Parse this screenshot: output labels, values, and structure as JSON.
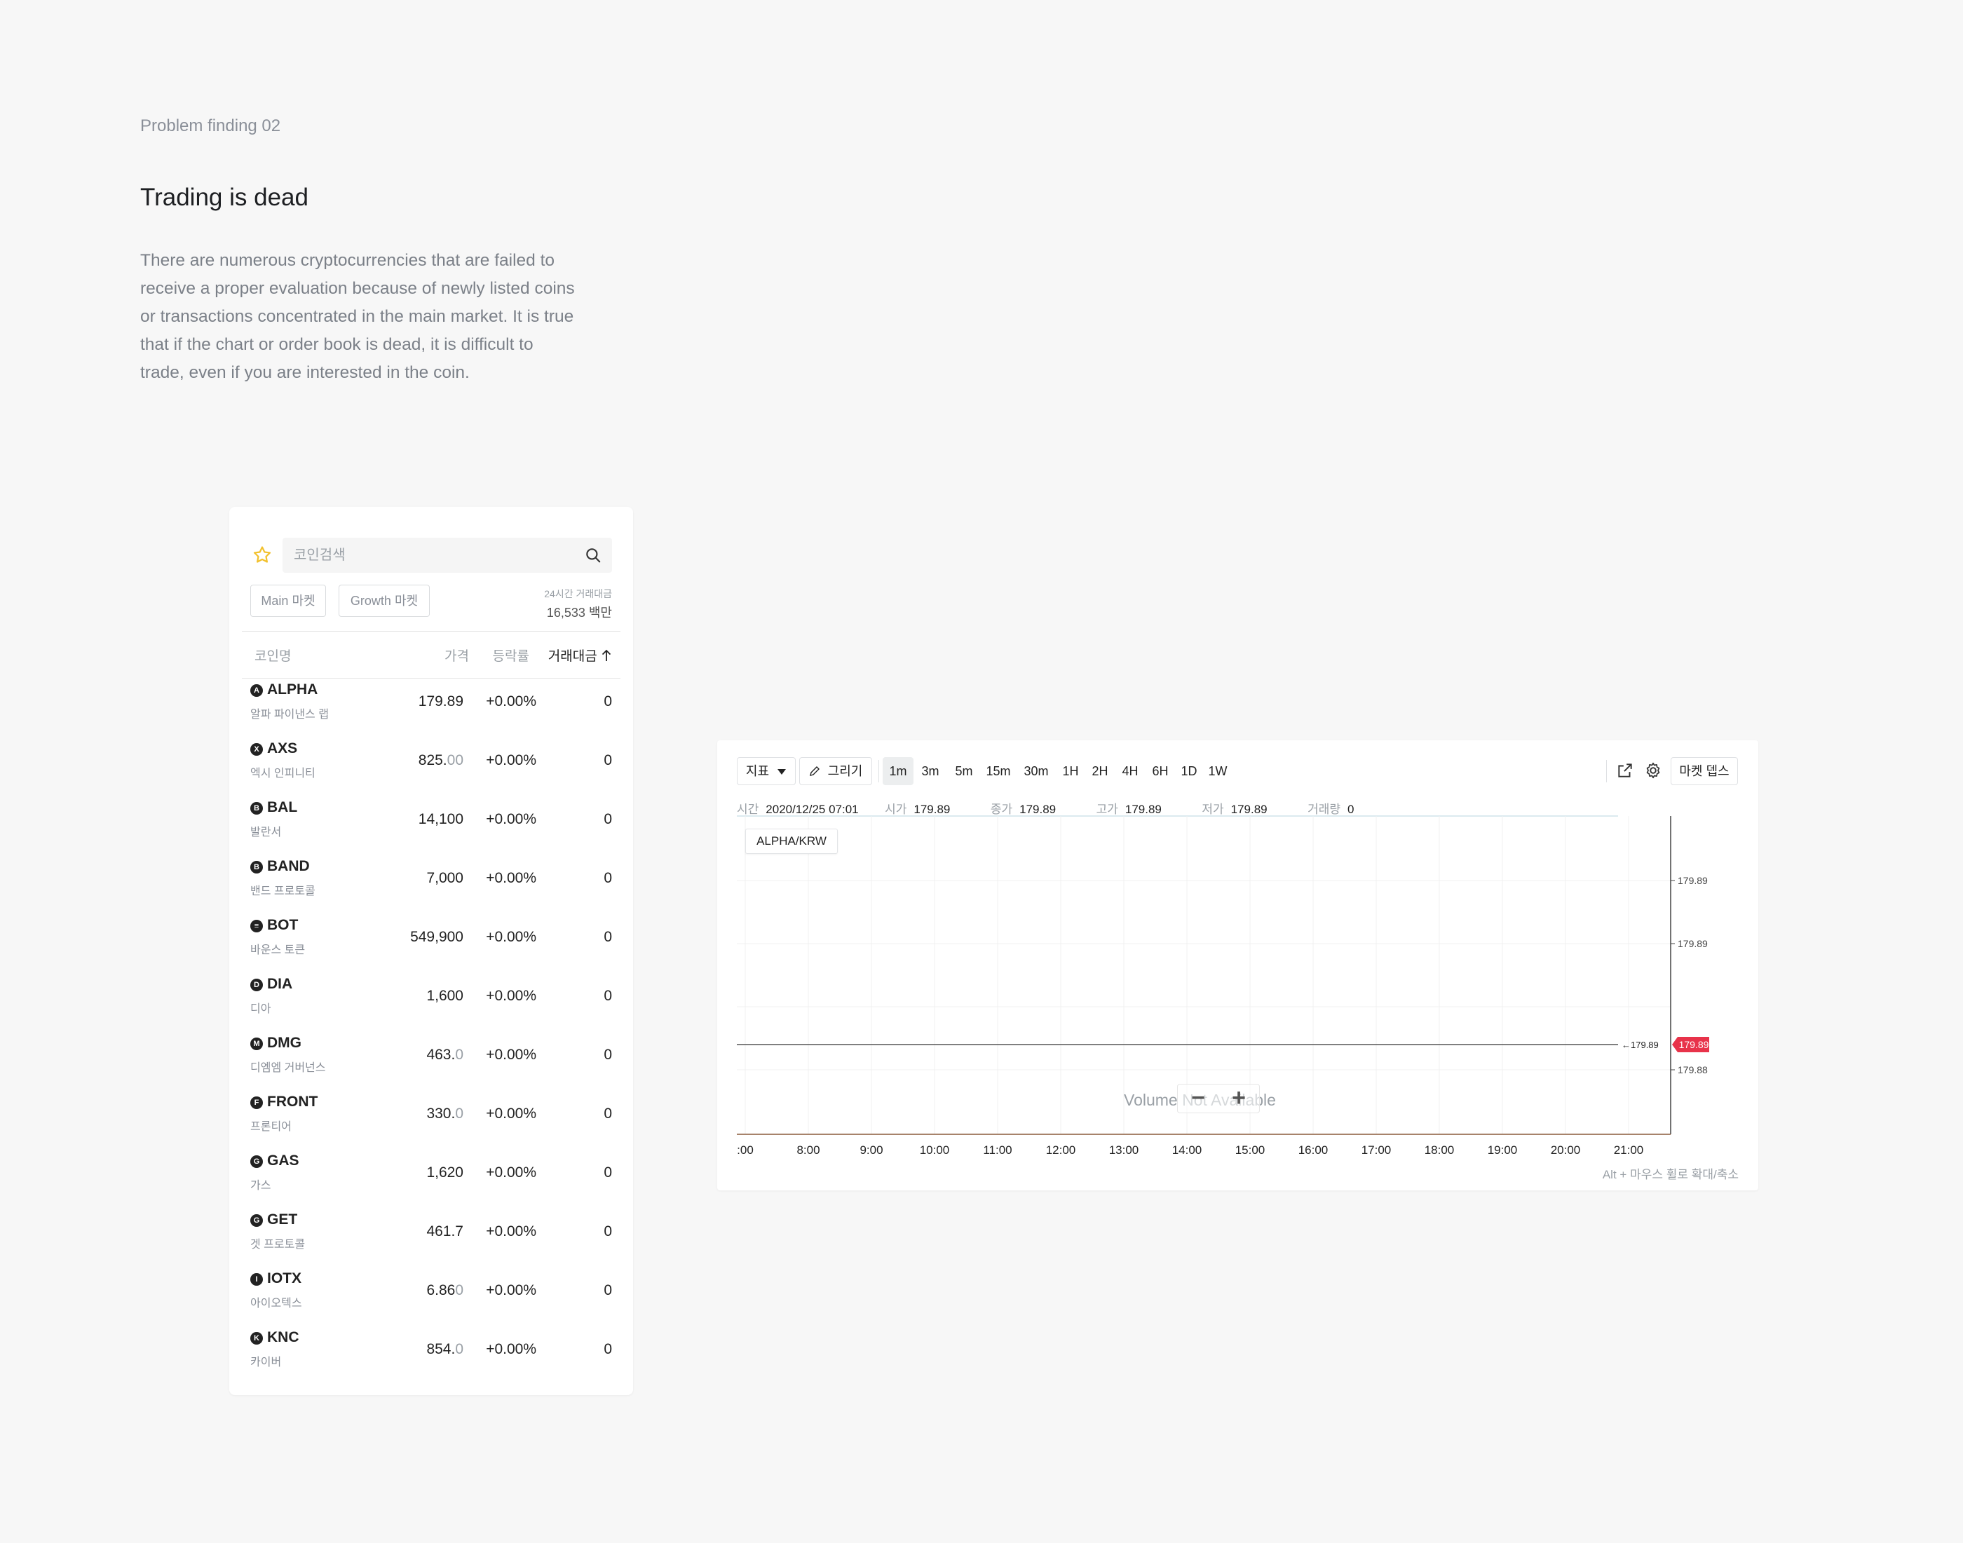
{
  "page": {
    "label": "Problem finding 02",
    "headline": "Trading is dead",
    "body_lines": [
      "There are numerous cryptocurrencies that are failed to",
      "receive a proper evaluation because of newly listed coins",
      "or transactions concentrated in the main market. It is true",
      "that if the chart or order book is dead, it is difficult to",
      "trade, even if you are interested in the coin."
    ]
  },
  "coin_list": {
    "search_placeholder": "코인검색",
    "markets": [
      "Main 마켓",
      "Growth 마켓"
    ],
    "volume_label": "24시간 거래대금",
    "volume_value": "16,533 백만",
    "headers": {
      "name": "코인명",
      "price": "가격",
      "change": "등락률",
      "volume": "거래대금",
      "sort_icon": "arrow-up-icon"
    },
    "rows": [
      {
        "icon": "A",
        "symbol": "ALPHA",
        "name": "알파 파이낸스 랩",
        "price": "179.89",
        "price_dim": "",
        "change": "+0.00%",
        "volume": "0"
      },
      {
        "icon": "X",
        "symbol": "AXS",
        "name": "엑시 인피니티",
        "price": "825.",
        "price_dim": "00",
        "change": "+0.00%",
        "volume": "0"
      },
      {
        "icon": "B",
        "symbol": "BAL",
        "name": "발란서",
        "price": "14,100",
        "price_dim": "",
        "change": "+0.00%",
        "volume": "0"
      },
      {
        "icon": "B",
        "symbol": "BAND",
        "name": "밴드 프로토콜",
        "price": "7,000",
        "price_dim": "",
        "change": "+0.00%",
        "volume": "0"
      },
      {
        "icon": "≡",
        "symbol": "BOT",
        "name": "바운스 토큰",
        "price": "549,900",
        "price_dim": "",
        "change": "+0.00%",
        "volume": "0"
      },
      {
        "icon": "D",
        "symbol": "DIA",
        "name": "디아",
        "price": "1,600",
        "price_dim": "",
        "change": "+0.00%",
        "volume": "0"
      },
      {
        "icon": "M",
        "symbol": "DMG",
        "name": "디엠엠 거버넌스",
        "price": "463.",
        "price_dim": "0",
        "change": "+0.00%",
        "volume": "0"
      },
      {
        "icon": "F",
        "symbol": "FRONT",
        "name": "프론티어",
        "price": "330.",
        "price_dim": "0",
        "change": "+0.00%",
        "volume": "0"
      },
      {
        "icon": "G",
        "symbol": "GAS",
        "name": "가스",
        "price": "1,620",
        "price_dim": "",
        "change": "+0.00%",
        "volume": "0"
      },
      {
        "icon": "G",
        "symbol": "GET",
        "name": "겟 프로토콜",
        "price": "461.7",
        "price_dim": "",
        "change": "+0.00%",
        "volume": "0"
      },
      {
        "icon": "I",
        "symbol": "IOTX",
        "name": "아이오텍스",
        "price": "6.86",
        "price_dim": "0",
        "change": "+0.00%",
        "volume": "0"
      },
      {
        "icon": "K",
        "symbol": "KNC",
        "name": "카이버",
        "price": "854.",
        "price_dim": "0",
        "change": "+0.00%",
        "volume": "0"
      }
    ]
  },
  "chart_panel": {
    "toolbar": {
      "indicator": "지표",
      "draw": "그리기",
      "timeframes": [
        "1m",
        "3m",
        "5m",
        "15m",
        "30m",
        "1H",
        "2H",
        "4H",
        "6H",
        "1D",
        "1W"
      ],
      "active_timeframe": "1m",
      "market_depth": "마켓 뎁스",
      "icons": [
        "external-link-icon",
        "settings-gear-icon"
      ]
    },
    "info": {
      "time_label": "시간",
      "time_value": "2020/12/25 07:01",
      "open_label": "시가",
      "open_value": "179.89",
      "close_label": "종가",
      "close_value": "179.89",
      "high_label": "고가",
      "high_value": "179.89",
      "low_label": "저가",
      "low_value": "179.89",
      "volume_label": "거래량",
      "volume_value": "0"
    },
    "pair": "ALPHA/KRW",
    "volume_not_available": "Volume Not Available",
    "zoom_out": "−",
    "zoom_in": "+",
    "hint": "Alt + 마우스 휠로 확대/축소",
    "price_tag": "179.89",
    "last_price_marker": "←179.89",
    "accent": "#e8334a"
  },
  "chart_data": {
    "type": "line",
    "xlabel": "",
    "ylabel": "",
    "x_ticks": [
      ":00",
      "8:00",
      "9:00",
      "10:00",
      "11:00",
      "12:00",
      "13:00",
      "14:00",
      "15:00",
      "16:00",
      "17:00",
      "18:00",
      "19:00",
      "20:00",
      "21:00"
    ],
    "y_ticks": [
      "179.89",
      "179.89",
      "179.88"
    ],
    "series": [
      {
        "values": [
          179.89,
          179.89
        ]
      }
    ],
    "grid": true
  }
}
